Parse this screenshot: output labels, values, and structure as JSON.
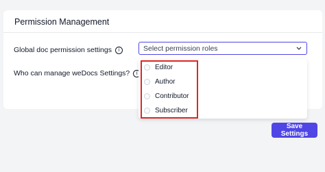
{
  "card": {
    "title": "Permission Management"
  },
  "rows": [
    {
      "label": "Global doc permission settings",
      "info_icon": "info-icon"
    },
    {
      "label": "Who can manage weDocs Settings?",
      "info_icon": "info-icon"
    }
  ],
  "select": {
    "placeholder": "Select permission roles",
    "icon": "chevron-down-icon"
  },
  "dropdown": {
    "options": [
      "Editor",
      "Author",
      "Contributor",
      "Subscriber"
    ],
    "highlight_color": "#dc2626"
  },
  "save_button": {
    "label": "Save Settings",
    "color": "#4f46e5"
  },
  "colors": {
    "accent": "#4f46e5",
    "background": "#f3f4f6"
  }
}
